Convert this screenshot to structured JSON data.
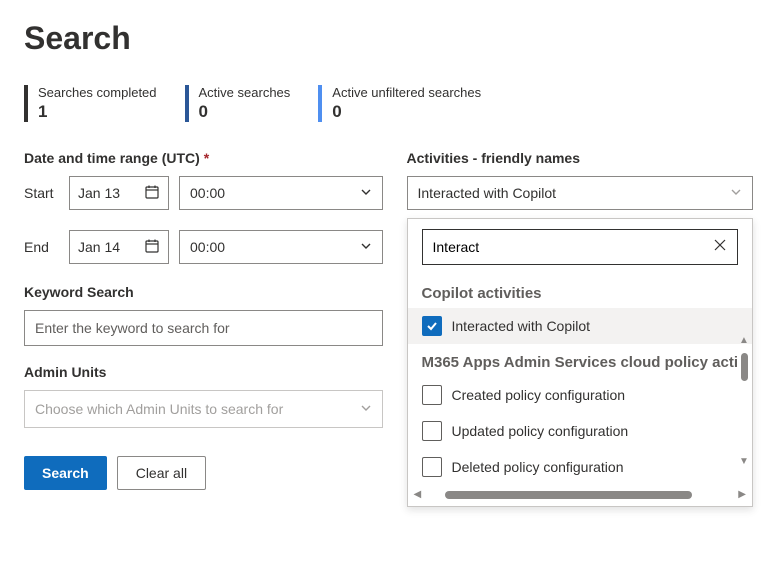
{
  "page_title": "Search",
  "stats": [
    {
      "label": "Searches completed",
      "value": "1"
    },
    {
      "label": "Active searches",
      "value": "0"
    },
    {
      "label": "Active unfiltered searches",
      "value": "0"
    }
  ],
  "daterange": {
    "section_label": "Date and time range (UTC)",
    "required_marker": "*",
    "start_label": "Start",
    "end_label": "End",
    "start_date": "Jan 13",
    "start_time": "00:00",
    "end_date": "Jan 14",
    "end_time": "00:00"
  },
  "keyword": {
    "label": "Keyword Search",
    "placeholder": "Enter the keyword to search for"
  },
  "admin_units": {
    "label": "Admin Units",
    "placeholder": "Choose which Admin Units to search for"
  },
  "buttons": {
    "search": "Search",
    "clear": "Clear all"
  },
  "activities": {
    "section_label": "Activities - friendly names",
    "selected": "Interacted with Copilot",
    "search_value": "Interact",
    "groups": [
      {
        "label": "Copilot activities",
        "options": [
          {
            "label": "Interacted with Copilot",
            "checked": true
          }
        ]
      },
      {
        "label": "M365 Apps Admin Services cloud policy acti",
        "options": [
          {
            "label": "Created policy configuration",
            "checked": false
          },
          {
            "label": "Updated policy configuration",
            "checked": false
          },
          {
            "label": "Deleted policy configuration",
            "checked": false
          }
        ]
      }
    ]
  }
}
